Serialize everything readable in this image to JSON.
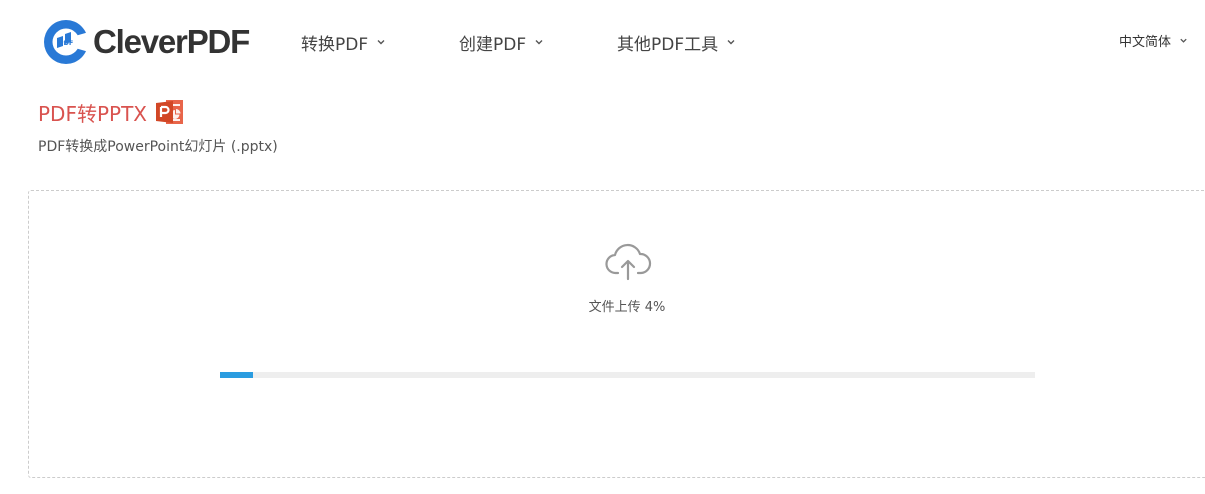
{
  "brand": {
    "name": "CleverPDF",
    "mark_text": "PDF",
    "blue": "#2979d6",
    "dark": "#333333"
  },
  "nav": {
    "convert": "转换PDF",
    "create": "创建PDF",
    "tools": "其他PDF工具"
  },
  "language": {
    "selected": "中文简体"
  },
  "tool": {
    "title": "PDF转PPTX",
    "subtitle": "PDF转换成PowerPoint幻灯片 (.pptx)",
    "title_color": "#d9534f",
    "icon": "powerpoint-icon"
  },
  "upload": {
    "icon": "cloud-upload-icon",
    "status": "文件上传 4%",
    "progress": 0.04,
    "progress_color": "#2a9ce0"
  }
}
